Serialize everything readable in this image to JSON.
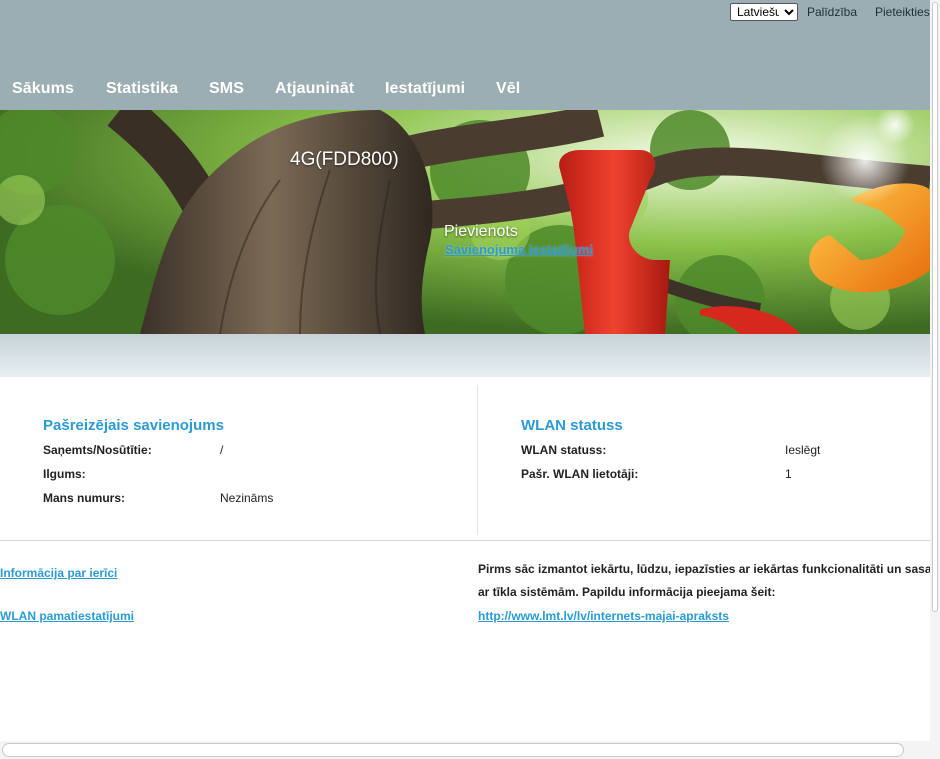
{
  "header": {
    "language_selected": "Latviešu",
    "language_options": [
      "Latviešu"
    ],
    "help_label": "Palīdzība",
    "login_label": "Pieteikties"
  },
  "nav": {
    "items": [
      {
        "label": "Sākums"
      },
      {
        "label": "Statistika"
      },
      {
        "label": "SMS"
      },
      {
        "label": "Atjaunināt"
      },
      {
        "label": "Iestatījumi"
      },
      {
        "label": "Vēl"
      }
    ]
  },
  "banner": {
    "network_type": "4G(FDD800)",
    "connection_status": "Pievienots",
    "connection_settings_link": "Savienojuma iestatījumi"
  },
  "current_connection": {
    "title": "Pašreizējais savienojums",
    "rows": [
      {
        "label": "Saņemts/Nosūtītie:",
        "value": "/"
      },
      {
        "label": "Ilgums:",
        "value": ""
      },
      {
        "label": "Mans numurs:",
        "value": "Nezināms"
      }
    ]
  },
  "wlan_status": {
    "title": "WLAN statuss",
    "rows": [
      {
        "label": "WLAN statuss:",
        "value": "Ieslēgt"
      },
      {
        "label": "Pašr. WLAN lietotāji:",
        "value": "1"
      }
    ]
  },
  "footer": {
    "links": [
      "Informācija par ierīci",
      "WLAN pamatiestatījumi"
    ],
    "notice_line1": "Pirms sāc izmantot iekārtu, lūdzu, iepazīsties ar iekārtas funkcionalitāti un sasa",
    "notice_line2": "ar tīkla sistēmām. Papildu informācija pieejama šeit:",
    "notice_link": "http://www.lmt.lv/lv/internets-majai-apraksts"
  },
  "colors": {
    "header_bg": "#9aaeb3",
    "link_blue": "#2a9bd6",
    "brand_red": "#e8372a",
    "brand_orange": "#f29a1e"
  }
}
